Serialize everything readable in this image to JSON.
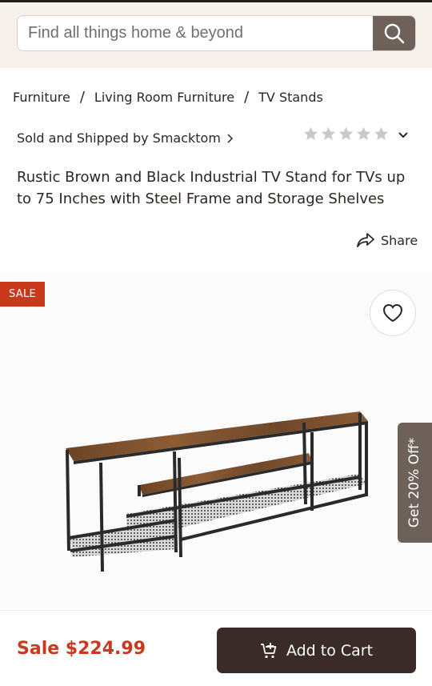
{
  "search": {
    "placeholder": "Find all things home & beyond",
    "button_icon": "search-icon"
  },
  "breadcrumb": {
    "items": [
      "Furniture",
      "Living Room Furniture",
      "TV Stands"
    ],
    "separator": "/"
  },
  "seller": {
    "label": "Sold and Shipped by Smacktom",
    "chevron_icon": "chevron-right-icon"
  },
  "rating": {
    "stars_filled": 0,
    "stars_total": 5,
    "toggle_icon": "chevron-down-icon"
  },
  "product": {
    "title": "Rustic Brown and Black Industrial TV Stand for TVs up to 75 Inches with Steel Frame and Storage Shelves",
    "sale_badge": "SALE",
    "share_label": "Share",
    "wishlist_icon": "heart-icon"
  },
  "promo": {
    "label": "Get 20% Off*"
  },
  "purchase": {
    "price_label": "Sale $224.99",
    "add_to_cart_label": "Add to Cart",
    "cart_icon": "cart-add-icon"
  },
  "colors": {
    "accent_brown": "#6e6159",
    "sale_red": "#c8381a",
    "cart_button": "#3a2a28",
    "header_bg": "#f6f1ea"
  }
}
